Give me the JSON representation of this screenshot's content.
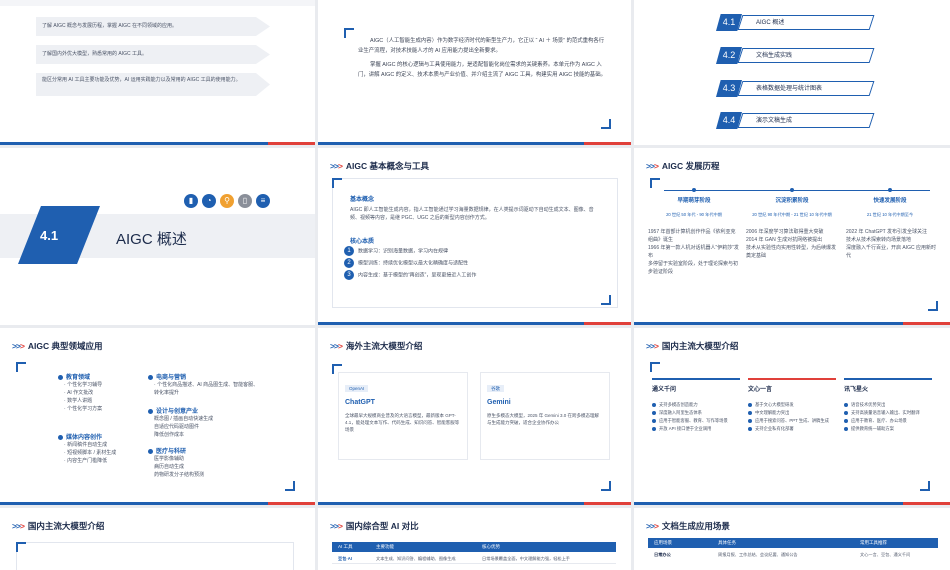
{
  "slide1": {
    "items": [
      "了解 AIGC 概念与发展历程，掌握 AIGC 在不同领域的应用。",
      "了解国内外优大模型，熟悉常用的 AIGC 工具。",
      "能区分常用 AI 工具主要功能及优势，AI 运用实践能力以及常用的 AIGC 工具的使用能力。"
    ]
  },
  "slide2": {
    "para1": "AIGC（人工智能生成内容）作为数字经济时代的新型生产力，它正以 “ AI ＋ 场景” 的范式重构各行业生产流程，对技术技能人才的 AI 应用能力提出全新要求。",
    "para2": "掌握 AIGC 的核心逻辑与工具使用能力，是适配智能化岗位需求的关键素养。本单元作为 AIGC 入门，讲解 AIGC 的定义、技术本质与产业价值、并介绍主流了 AIGC 工具，构建实用 AIGC 技能的基础。"
  },
  "slide3": {
    "toc": [
      {
        "num": "4.1",
        "label": "AIGC 概述"
      },
      {
        "num": "4.2",
        "label": "文档生成实践"
      },
      {
        "num": "4.3",
        "label": "表格数据处理与统计图表"
      },
      {
        "num": "4.4",
        "label": "演示文稿生成"
      }
    ]
  },
  "slide4": {
    "num": "4.1",
    "title": "AIGC 概述",
    "icons": [
      "chart-icon",
      "pie-icon",
      "search-icon",
      "document-icon",
      "list-icon"
    ],
    "colors": {
      "blue": "#1f5fb0",
      "orange": "#f0a030",
      "gray": "#8a8f99"
    }
  },
  "slide5": {
    "title": "AIGC 基本概念与工具",
    "heading": "基本概念",
    "text": "AIGC 即人工智能生成内容，指人工智能通过学习海量数据规律，在人类提示词驱动下自动生成文本、图像、音频、视频等内容，是继 PGC、UGC 之后的新型内容创作方式。",
    "sub": "核心本质",
    "points": [
      "数据学习：识别海量数据，学习内在规律",
      "模型训练：持续优化模型以最大化精确度与适配性",
      "内容生成：基于模型的“再创造”，呈现更接近人工创作"
    ]
  },
  "slide6": {
    "title": "AIGC 发展历程",
    "stages": [
      {
        "name": "早期萌芽阶段",
        "years": "20 世纪 50 年代 - 90 年代中期",
        "lines": [
          "1957 年首部计算机创作作品《依利亚克组曲》诞生",
          "1966 年第一款人机对话机器人“伊莉莎”发布",
          "多停留于实验室阶段，处于理论探索与初步验证阶段"
        ]
      },
      {
        "name": "沉淀积累阶段",
        "years": "20 世纪 90 年代中期 - 21 世纪 10 年代中期",
        "lines": [
          "2006 年深度学习算法取得重大突破",
          "2014 年 GAN 生成对抗网络被提出",
          "技术从实验性向实用性转型，为后续爆发奠定基础"
        ]
      },
      {
        "name": "快速发展阶段",
        "years": "21 世纪 10 年代中期至今",
        "lines": [
          "2022 年 ChatGPT 发布引发全球关注",
          "技术从技术探索转向场景落地",
          "深度融入千行百业，开启 AIGC 应用新时代"
        ]
      }
    ]
  },
  "slide7": {
    "title": "AIGC 典型领域应用",
    "groups": [
      {
        "name": "教育领域",
        "lines": [
          "个性化学习辅导",
          "AI 作文批改",
          "数学人讲题",
          "个性化学习方案"
        ]
      },
      {
        "name": "电商与营销",
        "lines": [
          "个性化商品描述、AI 商品图生成、智能客服、转化率提升"
        ]
      },
      {
        "name": "设计与创意产业",
        "lines": [
          "概念图 / 插画自动快速生成",
          "自适应代码驱动图件",
          "降低创作成本"
        ]
      },
      {
        "name": "媒体内容创作",
        "lines": [
          "新闻稿件自动生成",
          "短视频脚本 / 素材生成",
          "内容生产门槛降低"
        ]
      },
      {
        "name": "医疗与科研",
        "lines": [
          "医学影像辅助",
          "病历自动生成",
          "药物研发分子结构预测"
        ]
      }
    ]
  },
  "slide8": {
    "title": "海外主流大模型介绍",
    "cards": [
      {
        "tag": "OpenAI",
        "name": "ChatGPT",
        "text": "全球最早大规模商业普及的大语言模型，最新版本 GPT-4.1，能处理文本写作、代码生成、知识问答、智能客服等场景"
      },
      {
        "tag": "谷歌",
        "name": "Gemini",
        "text": "原生多模态大模型，2025 年 Gemini 3.0 在跨多模态理解与生成能力突破，适合企业协作办公"
      }
    ]
  },
  "slide9": {
    "title": "国内主流大模型介绍",
    "cols": [
      {
        "name": "通义千问",
        "lines": [
          "支持多模态创造能力",
          "深度融入阿里生态体系",
          "应用于智能客服、教育、写作等场景",
          "开放 API 接口便于企业调用"
        ]
      },
      {
        "name": "文心一言",
        "lines": [
          "基于文心大模型研发",
          "中文理解能力突出",
          "应用于搜索问答、PPT 生成、讲稿生成",
          "支持企业私有化部署"
        ]
      },
      {
        "name": "讯飞星火",
        "lines": [
          "语音技术优势突出",
          "支持高质量语音输入输出、实时翻译",
          "应用于教育、医疗、办公场景",
          "提供教育统一辅助方案"
        ]
      }
    ]
  },
  "slide10": {
    "title": "国内主流大模型介绍"
  },
  "slide11": {
    "title": "国内综合型 AI 对比",
    "headers": [
      "AI 工具",
      "主要功能",
      "核心优势"
    ],
    "row": [
      "豆包·AI",
      "文本生成、知识问答、编程辅助、图像生成",
      "日常场景覆盖全面，中文理解能力强，轻松上手"
    ]
  },
  "slide12": {
    "title": "文档生成应用场景",
    "headers": [
      "应用场景",
      "具体任务",
      "常用工具推荐"
    ],
    "row": [
      "日常办公",
      "周报月报、工作总结、会议纪要、通知公告",
      "文心一言、豆包、通义千问"
    ]
  }
}
